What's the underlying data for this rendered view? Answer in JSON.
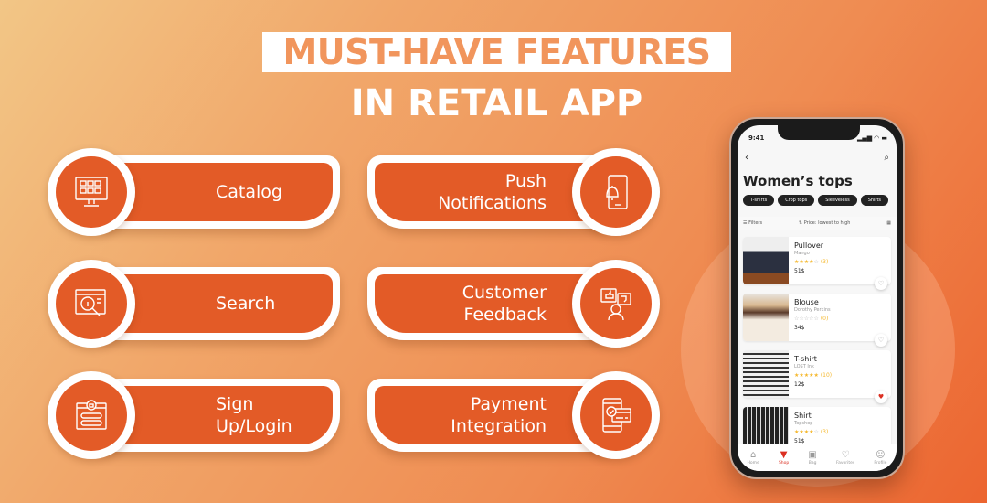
{
  "header": {
    "title_line1": "MUST-HAVE FEATURES",
    "title_line2": "IN RETAIL APP"
  },
  "colors": {
    "accent": "#e35b27",
    "title_highlight_text": "#f1955c",
    "background_start": "#f2c686",
    "background_end": "#ec6530"
  },
  "features": [
    {
      "label": "Catalog",
      "icon": "catalog-monitor-icon"
    },
    {
      "label": "Push Notifications",
      "icon": "phone-bell-icon"
    },
    {
      "label": "Search",
      "icon": "browser-search-icon"
    },
    {
      "label": "Customer Feedback",
      "icon": "feedback-thumbs-icon"
    },
    {
      "label": "Sign Up/Login",
      "icon": "login-lock-icon"
    },
    {
      "label": "Payment Integration",
      "icon": "phone-card-icon"
    }
  ],
  "phone": {
    "status_time": "9:41",
    "status_icons": "signal wifi battery",
    "back_glyph": "‹",
    "search_glyph": "⌕",
    "screen_title": "Women’s tops",
    "chips": [
      "T-shirts",
      "Crop tops",
      "Sleeveless",
      "Shirts"
    ],
    "filters_label": "Filters",
    "sort_label": "Price: lowest to high",
    "products": [
      {
        "name": "Pullover",
        "brand": "Mango",
        "rating": 4,
        "reviews": "(3)",
        "price": "51$",
        "favorite": false
      },
      {
        "name": "Blouse",
        "brand": "Dorothy Perkins",
        "rating": 0,
        "reviews": "(0)",
        "price": "34$",
        "favorite": false
      },
      {
        "name": "T-shirt",
        "brand": "LOST Ink",
        "rating": 5,
        "reviews": "(10)",
        "price": "12$",
        "favorite": true
      },
      {
        "name": "Shirt",
        "brand": "Topshop",
        "rating": 4,
        "reviews": "(3)",
        "price": "51$",
        "favorite": false
      }
    ],
    "tabs": [
      {
        "label": "Home",
        "glyph": "⌂",
        "active": false
      },
      {
        "label": "Shop",
        "glyph": "🛒",
        "active": true
      },
      {
        "label": "Bag",
        "glyph": "▣",
        "active": false
      },
      {
        "label": "Favorites",
        "glyph": "♡",
        "active": false
      },
      {
        "label": "Profile",
        "glyph": "☺",
        "active": false
      }
    ]
  }
}
